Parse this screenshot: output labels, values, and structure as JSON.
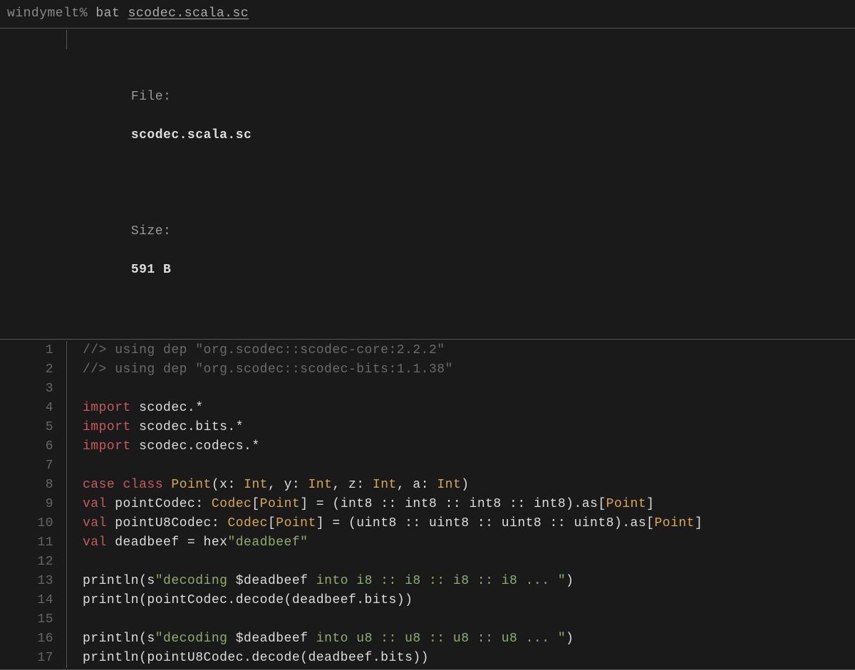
{
  "prompt": {
    "user": "windymelt%",
    "command": "bat",
    "arg": "scodec.scala.sc"
  },
  "header": {
    "file_label": "File:",
    "file_value": "scodec.scala.sc",
    "size_label": "Size:",
    "size_value": "591 B"
  },
  "lines": [
    {
      "n": "1",
      "tokens": [
        {
          "t": "//> using dep \"org.scodec::scodec-core:2.2.2\"",
          "c": "c-comment"
        }
      ]
    },
    {
      "n": "2",
      "tokens": [
        {
          "t": "//> using dep \"org.scodec::scodec-bits:1.1.38\"",
          "c": "c-comment"
        }
      ]
    },
    {
      "n": "3",
      "tokens": []
    },
    {
      "n": "4",
      "tokens": [
        {
          "t": "import",
          "c": "c-keyword"
        },
        {
          "t": " scodec.*",
          "c": "c-ident"
        }
      ]
    },
    {
      "n": "5",
      "tokens": [
        {
          "t": "import",
          "c": "c-keyword"
        },
        {
          "t": " scodec.bits.*",
          "c": "c-ident"
        }
      ]
    },
    {
      "n": "6",
      "tokens": [
        {
          "t": "import",
          "c": "c-keyword"
        },
        {
          "t": " scodec.codecs.*",
          "c": "c-ident"
        }
      ]
    },
    {
      "n": "7",
      "tokens": []
    },
    {
      "n": "8",
      "tokens": [
        {
          "t": "case class",
          "c": "c-keyword"
        },
        {
          "t": " ",
          "c": "c-ident"
        },
        {
          "t": "Point",
          "c": "c-type"
        },
        {
          "t": "(x: ",
          "c": "c-paren"
        },
        {
          "t": "Int",
          "c": "c-type"
        },
        {
          "t": ", y: ",
          "c": "c-paren"
        },
        {
          "t": "Int",
          "c": "c-type"
        },
        {
          "t": ", z: ",
          "c": "c-paren"
        },
        {
          "t": "Int",
          "c": "c-type"
        },
        {
          "t": ", a: ",
          "c": "c-paren"
        },
        {
          "t": "Int",
          "c": "c-type"
        },
        {
          "t": ")",
          "c": "c-paren"
        }
      ]
    },
    {
      "n": "9",
      "tokens": [
        {
          "t": "val",
          "c": "c-keyword"
        },
        {
          "t": " pointCodec: ",
          "c": "c-ident"
        },
        {
          "t": "Codec",
          "c": "c-type"
        },
        {
          "t": "[",
          "c": "c-paren"
        },
        {
          "t": "Point",
          "c": "c-type"
        },
        {
          "t": "] = (int8 :: int8 :: int8 :: int8).as[",
          "c": "c-ident"
        },
        {
          "t": "Point",
          "c": "c-type"
        },
        {
          "t": "]",
          "c": "c-paren"
        }
      ]
    },
    {
      "n": "10",
      "tokens": [
        {
          "t": "val",
          "c": "c-keyword"
        },
        {
          "t": " pointU8Codec: ",
          "c": "c-ident"
        },
        {
          "t": "Codec",
          "c": "c-type"
        },
        {
          "t": "[",
          "c": "c-paren"
        },
        {
          "t": "Point",
          "c": "c-type"
        },
        {
          "t": "] = (uint8 :: uint8 :: uint8 :: uint8).as[",
          "c": "c-ident"
        },
        {
          "t": "Point",
          "c": "c-type"
        },
        {
          "t": "]",
          "c": "c-paren"
        }
      ]
    },
    {
      "n": "11",
      "tokens": [
        {
          "t": "val",
          "c": "c-keyword"
        },
        {
          "t": " deadbeef = hex",
          "c": "c-ident"
        },
        {
          "t": "\"deadbeef\"",
          "c": "c-string"
        }
      ]
    },
    {
      "n": "12",
      "tokens": []
    },
    {
      "n": "13",
      "tokens": [
        {
          "t": "println(s",
          "c": "c-func"
        },
        {
          "t": "\"decoding ",
          "c": "c-string"
        },
        {
          "t": "$deadbeef",
          "c": "c-interp"
        },
        {
          "t": " into i8 :: i8 :: i8 :: i8 ... \"",
          "c": "c-string"
        },
        {
          "t": ")",
          "c": "c-func"
        }
      ]
    },
    {
      "n": "14",
      "tokens": [
        {
          "t": "println(pointCodec.decode(deadbeef.bits))",
          "c": "c-func"
        }
      ]
    },
    {
      "n": "15",
      "tokens": []
    },
    {
      "n": "16",
      "tokens": [
        {
          "t": "println(s",
          "c": "c-func"
        },
        {
          "t": "\"decoding ",
          "c": "c-string"
        },
        {
          "t": "$deadbeef",
          "c": "c-interp"
        },
        {
          "t": " into u8 :: u8 :: u8 :: u8 ... \"",
          "c": "c-string"
        },
        {
          "t": ")",
          "c": "c-func"
        }
      ]
    },
    {
      "n": "17",
      "tokens": [
        {
          "t": "println(pointU8Codec.decode(deadbeef.bits))",
          "c": "c-func"
        }
      ]
    }
  ]
}
